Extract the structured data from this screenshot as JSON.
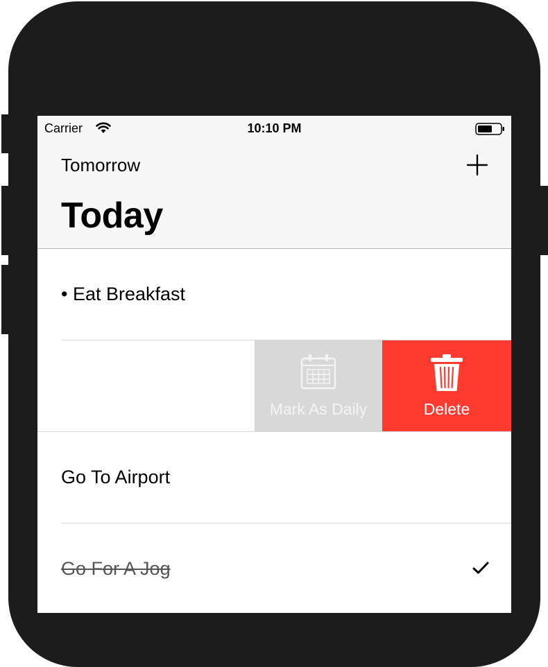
{
  "status_bar": {
    "carrier": "Carrier",
    "time": "10:10 PM",
    "wifi_icon": "wifi-icon",
    "battery_icon": "battery-icon"
  },
  "nav": {
    "back_label": "Tomorrow",
    "add_icon": "plus-icon",
    "title": "Today"
  },
  "tasks": [
    {
      "label": "• Eat Breakfast",
      "completed": false
    },
    {
      "label": "",
      "completed": false,
      "swipe_actions": true
    },
    {
      "label": "Go To Airport",
      "completed": false
    },
    {
      "label": "Go For A Jog",
      "completed": true
    }
  ],
  "swipe_actions": {
    "mark_daily_label": "Mark As Daily",
    "mark_daily_icon": "calendar-icon",
    "delete_label": "Delete",
    "delete_icon": "trash-icon"
  },
  "colors": {
    "delete": "#ff3b30",
    "mark_daily": "#d8d8d8",
    "bar_background": "#f7f7f7",
    "device_frame": "#1c1c1c"
  }
}
